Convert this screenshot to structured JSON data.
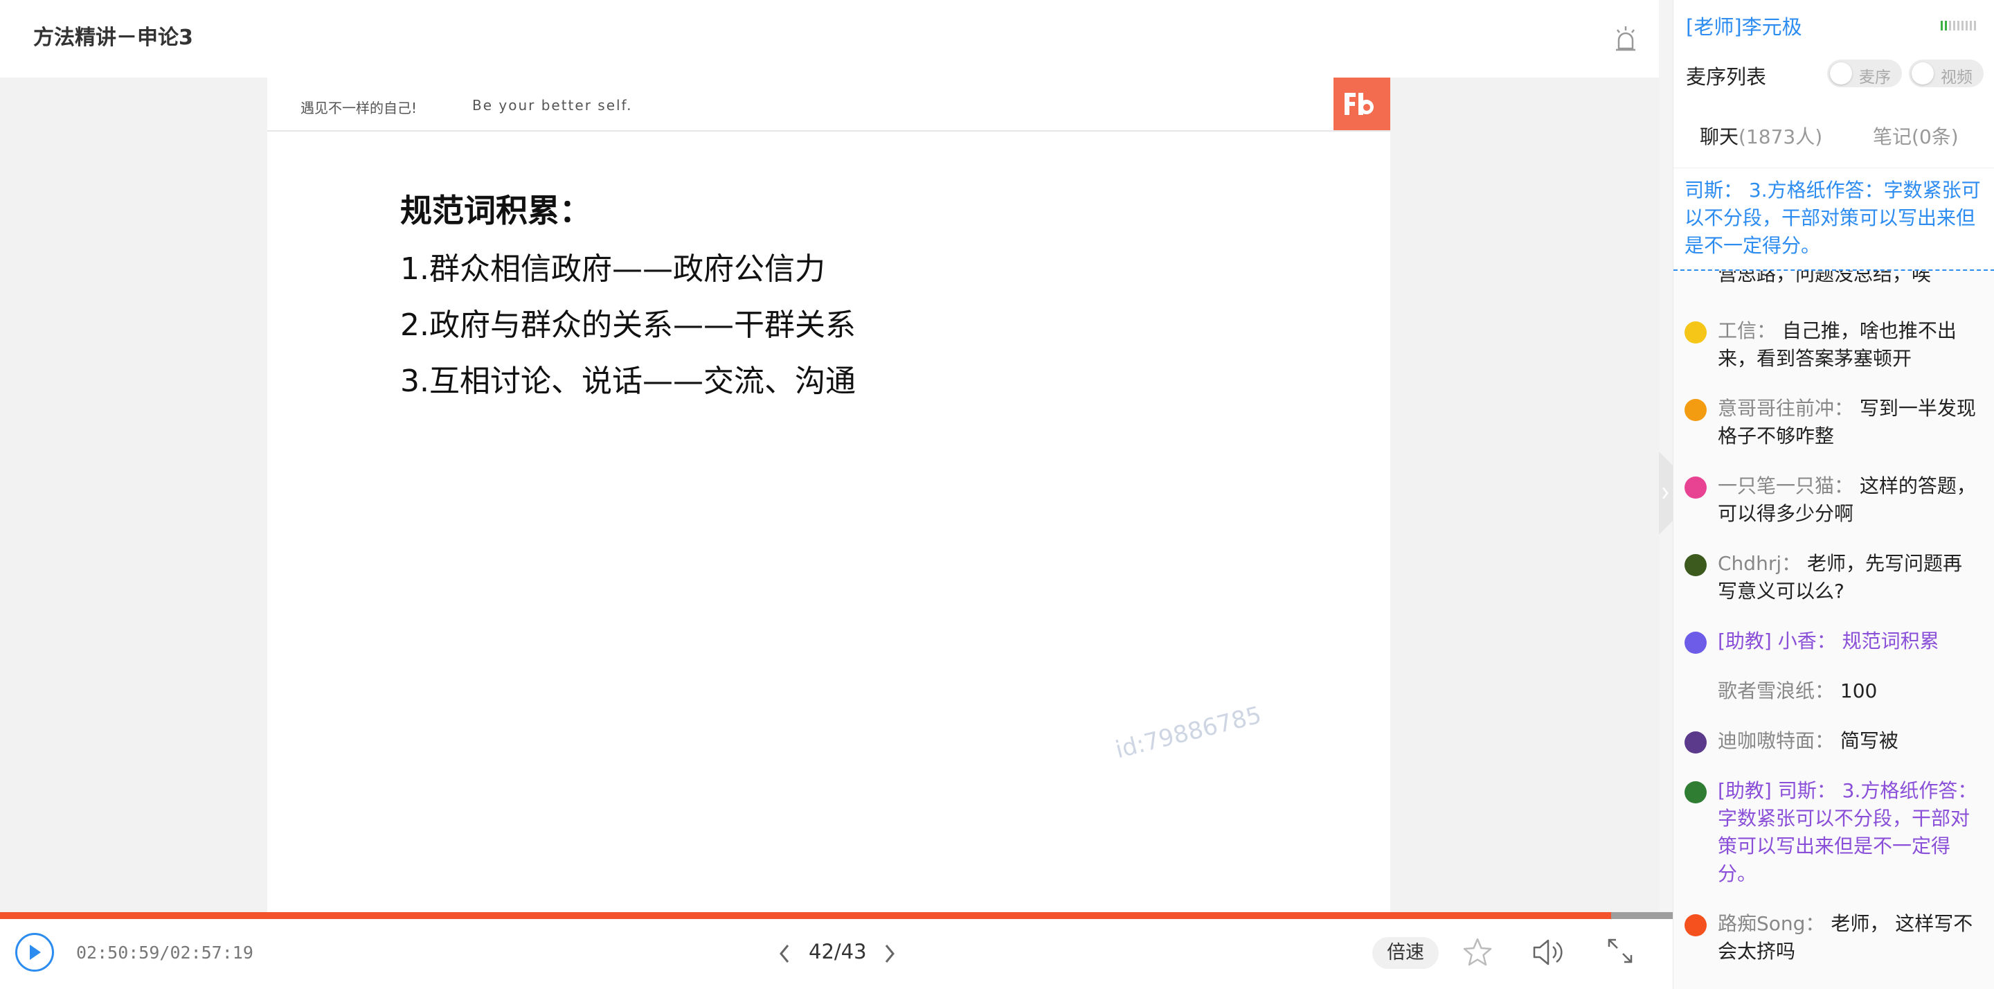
{
  "header": {
    "title": "方法精讲－申论3"
  },
  "slide": {
    "slogan_cn": "遇见不一样的自己!",
    "slogan_en": "Be your better self.",
    "logo_text": "Fb",
    "heading": "规范词积累：",
    "lines": [
      "1.群众相信政府——政府公信力",
      "2.政府与群众的关系——干群关系",
      "3.互相讨论、说话——交流、沟通"
    ],
    "watermark": "id:79886785"
  },
  "player": {
    "time": "02:50:59/02:57:19",
    "progress_fraction": 0.963,
    "page": "42/43",
    "speed_label": "倍速"
  },
  "sidebar": {
    "teacher": "[老师]李元极",
    "queue_title": "麦序列表",
    "toggles": [
      {
        "label": "麦序"
      },
      {
        "label": "视频"
      }
    ],
    "tabs": {
      "chat_label": "聊天",
      "chat_count": "(1873人)",
      "notes_label": "笔记",
      "notes_count": "(0条)"
    },
    "pinned": "司斯： 3.方格纸作答：字数紧张可以不分段，干部对策可以写出来但是不一定得分。",
    "partial_message": "营思路，问题没总结，唉",
    "messages": [
      {
        "nick": "工信：",
        "text": "自己推，啥也推不出来，看到答案茅塞顿开",
        "avatar_color": "#f5c518",
        "ta": false
      },
      {
        "nick": "意哥哥往前冲：",
        "text": "写到一半发现格子不够咋整",
        "avatar_color": "#f39c12",
        "ta": false
      },
      {
        "nick": "一只笔一只猫：",
        "text": "这样的答题，可以得多少分啊",
        "avatar_color": "#e84393",
        "ta": false
      },
      {
        "nick": "Chdhrj：",
        "text": "老师，先写问题再写意义可以么?",
        "avatar_color": "#3d5a1e",
        "ta": false
      },
      {
        "nick": "[助教] 小香：",
        "text": "规范词积累",
        "avatar_color": "#6c5ce7",
        "ta": true
      },
      {
        "nick": "歌者雪浪纸：",
        "text": "100",
        "avatar_color": "",
        "ta": false
      },
      {
        "nick": "迪咖嗷特面：",
        "text": "简写被",
        "avatar_color": "#5b3a8c",
        "ta": false
      },
      {
        "nick": "[助教] 司斯：",
        "text": "3.方格纸作答：字数紧张可以不分段，干部对策可以写出来但是不一定得分。",
        "avatar_color": "#2e7d32",
        "ta": true
      },
      {
        "nick": "路痴Song：",
        "text": "老师， 这样写不会太挤吗",
        "avatar_color": "#f4511e",
        "ta": false
      }
    ]
  },
  "colors": {
    "accent": "#2d8cf0",
    "progress": "#f4522c",
    "logo": "#f36c4f",
    "ta": "#8a4fd8"
  },
  "icons": [
    "alert-icon",
    "play-icon",
    "chevron-left-icon",
    "chevron-right-icon",
    "star-icon",
    "volume-icon",
    "fullscreen-icon",
    "signal-icon",
    "collapse-icon"
  ]
}
